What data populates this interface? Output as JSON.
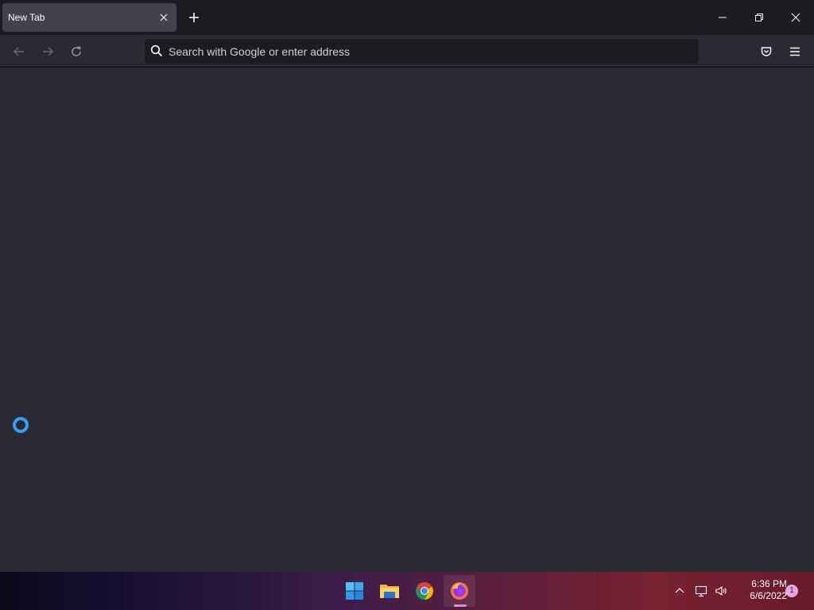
{
  "tabs": [
    {
      "title": "New Tab",
      "active": true
    }
  ],
  "toolbar": {
    "new_tab_icon": "plus-icon",
    "back_icon": "arrow-left-icon",
    "forward_icon": "arrow-right-icon",
    "reload_icon": "reload-icon",
    "pocket_icon": "pocket-icon",
    "menu_icon": "hamburger-menu-icon"
  },
  "urlbar": {
    "placeholder": "Search with Google or enter address",
    "value": "",
    "icon": "search-icon"
  },
  "window_controls": [
    "minimize-icon",
    "restore-icon",
    "close-icon"
  ],
  "content": {
    "loading_icon": "loading-ring-icon"
  },
  "taskbar": {
    "apps": [
      {
        "name": "Start",
        "icon": "windows-start-icon"
      },
      {
        "name": "File Explorer",
        "icon": "folder-icon"
      },
      {
        "name": "Google Chrome",
        "icon": "chrome-icon"
      },
      {
        "name": "Firefox",
        "icon": "firefox-icon",
        "active": true
      }
    ],
    "tray": {
      "chevron_icon": "chevron-up-icon",
      "network_icon": "network-icon",
      "volume_icon": "volume-icon"
    },
    "clock": {
      "time": "6:36 PM",
      "date": "6/6/2022"
    },
    "notification_count": "1"
  },
  "colors": {
    "tab_bg": "#42414d",
    "chrome_bg": "#1c1b22",
    "content_bg": "#2b2a33",
    "spinner": "#2ea1f5"
  }
}
